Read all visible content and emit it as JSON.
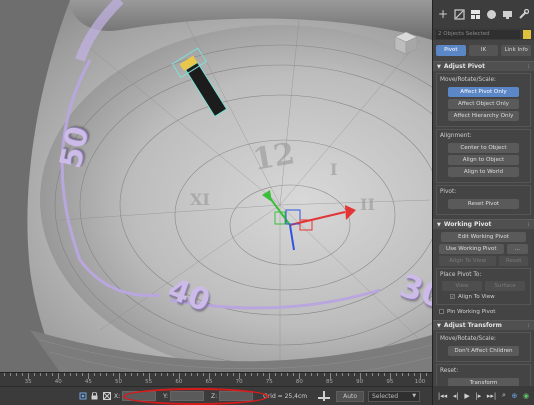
{
  "viewport": {
    "labels": {
      "forty": "40",
      "fifty": "50",
      "thirty": "30"
    }
  },
  "command_panel": {
    "tabs": [
      "create-icon",
      "modify-icon",
      "hierarchy-icon",
      "motion-icon",
      "display-icon",
      "utilities-icon"
    ],
    "selection_text": "2 Objects Selected",
    "selection_color": "#e1c23c",
    "subtabs": [
      "Pivot",
      "IK",
      "Link Info"
    ],
    "active_subtab": "Pivot",
    "adjust_pivot": {
      "title": "Adjust Pivot",
      "move_group": "Move/Rotate/Scale:",
      "affect_pivot_only": "Affect Pivot Only",
      "affect_object_only": "Affect Object Only",
      "affect_hierarchy_only": "Affect Hierarchy Only",
      "alignment_group": "Alignment:",
      "center_to_object": "Center to Object",
      "align_to_object": "Align to Object",
      "align_to_world": "Align to World",
      "pivot_group": "Pivot:",
      "reset_pivot": "Reset Pivot"
    },
    "working_pivot": {
      "title": "Working Pivot",
      "edit_working_pivot": "Edit Working Pivot",
      "use_working_pivot": "Use Working Pivot",
      "more": "...",
      "align_to_view": "Align To View",
      "reset": "Reset",
      "place_pivot_to": "Place Pivot To:",
      "view": "View",
      "surface": "Surface",
      "align_to_view_check": "Align To View",
      "align_to_view_checked": true,
      "pin_working_pivot": "Pin Working Pivot",
      "pin_checked": false
    },
    "adjust_transform": {
      "title": "Adjust Transform",
      "move_group": "Move/Rotate/Scale:",
      "dont_affect_children": "Don't Affect Children",
      "reset_group": "Reset:",
      "transform": "Transform"
    },
    "accent_color": "#5b87c7"
  },
  "timeline": {
    "ticks": [
      35,
      40,
      45,
      50,
      55,
      60,
      65,
      70,
      75,
      80,
      85,
      90,
      95,
      100
    ],
    "range": [
      31,
      101
    ]
  },
  "statusbar": {
    "x_label": "X:",
    "y_label": "Y:",
    "z_label": "Z:",
    "x_value": "",
    "y_value": "",
    "z_value": "",
    "grid": "Grid = 25,4cm",
    "auto": "Auto",
    "selected": "Selected",
    "annotation_color": "#d61b1b"
  }
}
